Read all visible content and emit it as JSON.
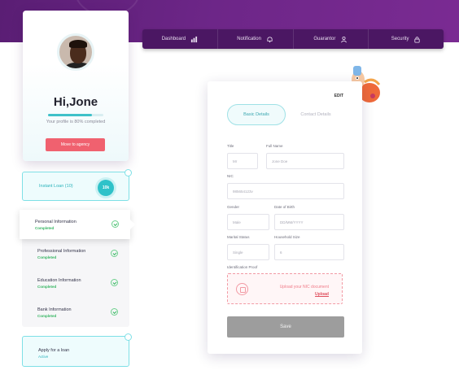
{
  "nav": {
    "items": [
      {
        "label": "Dashboard",
        "icon": "bar-chart-icon"
      },
      {
        "label": "Notification",
        "icon": "bell-icon"
      },
      {
        "label": "Guarantor",
        "icon": "user-icon"
      },
      {
        "label": "Security",
        "icon": "lock-icon"
      }
    ]
  },
  "profile": {
    "greeting": "Hi,Jone",
    "progress_fraction": 0.8,
    "completion_text": "Your profile is 80% completed",
    "agency_button": "Move to agency"
  },
  "loan": {
    "label": "Instant Loan (10)",
    "chip": "10k"
  },
  "steps": [
    {
      "label": "Personal Information",
      "status": "Completed"
    },
    {
      "label": "Professional Information",
      "status": "Completed"
    },
    {
      "label": "Education Information",
      "status": "Completed"
    },
    {
      "label": "Bank Information",
      "status": "Completed"
    }
  ],
  "apply": {
    "label": "Apply for a loan",
    "status": "Active"
  },
  "form": {
    "edit_label": "EDIT",
    "tabs": {
      "active": "Basic Details",
      "inactive": "Contact Details"
    },
    "fields": {
      "title_label": "Title",
      "title_value": "Mr",
      "fullname_label": "Full Name",
      "fullname_value": "Jone Doe",
      "nic_label": "NIC",
      "nic_value": "985654123v",
      "gender_label": "Gender",
      "gender_value": "Male",
      "dob_label": "Date of Birth",
      "dob_value": "DD/MM/YYYY",
      "marital_label": "Marital Status",
      "marital_value": "Single",
      "household_label": "Household Size",
      "household_value": "6",
      "idproof_label": "Identification Proof"
    },
    "upload": {
      "text": "Upload your NIC document",
      "link": "Upload"
    },
    "save_label": "Save"
  },
  "colors": {
    "brand_purple": "#6d2688",
    "accent_cyan": "#2fc2c9",
    "accent_red": "#f0616f",
    "success_green": "#35b561"
  }
}
